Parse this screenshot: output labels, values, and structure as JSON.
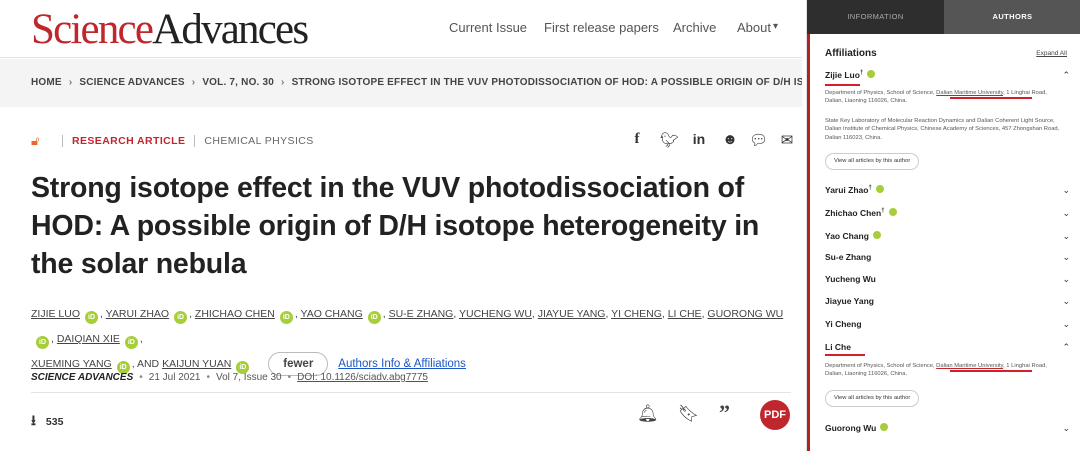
{
  "header": {
    "logo_science": "Science",
    "logo_advances": "Advances",
    "nav": [
      "Current Issue",
      "First release papers",
      "Archive",
      "About"
    ]
  },
  "breadcrumb": [
    "HOME",
    "SCIENCE ADVANCES",
    "VOL. 7, NO. 30",
    "STRONG ISOTOPE EFFECT IN THE VUV PHOTODISSOCIATION OF HOD: A POSSIBLE ORIGIN OF D/H ISOTOPE..."
  ],
  "article": {
    "category": "RESEARCH ARTICLE",
    "subject": "CHEMICAL PHYSICS",
    "title": "Strong isotope effect in the VUV photodissociation of HOD: A possible origin of D/H isotope heterogeneity in the solar nebula",
    "authors": [
      "ZIJIE LUO",
      "YARUI ZHAO",
      "ZHICHAO CHEN",
      "YAO CHANG",
      "SU-E ZHANG",
      "YUCHENG WU",
      "JIAYUE YANG",
      "YI CHENG",
      "LI CHE",
      "GUORONG WU",
      "DAIQIAN XIE",
      "XUEMING YANG",
      "KAIJUN YUAN"
    ],
    "and_text": ", AND",
    "fewer_label": "fewer",
    "authors_info_link": "Authors Info & Affiliations",
    "journal": "SCIENCE ADVANCES",
    "date": "21 Jul 2021",
    "volume": "Vol 7, Issue 30",
    "doi": "DOI: 10.1126/sciadv.abg7775",
    "downloads": "535",
    "pdf_label": "PDF"
  },
  "sidebar": {
    "tabs": [
      "INFORMATION",
      "AUTHORS"
    ],
    "heading": "Affiliations",
    "expand_all": "Expand All",
    "view_all_label": "View all articles by this author",
    "affil1_a": "Department of Physics, School of Science, ",
    "affil1_u": "Dalian Maritime University",
    "affil1_b": ", 1 Linghai Road, Dalian, Liaoning 116026, China.",
    "affil2": "State Key Laboratory of Molecular Reaction Dynamics and Dalian Coherent Light Source, Dalian Institute of Chemical Physics, Chinese Academy of Sciences, 457 Zhongshan Road, Dalian 116023, China.",
    "authors": [
      {
        "name": "Zijie Luo",
        "dagger": "†"
      },
      {
        "name": "Yarui Zhao",
        "dagger": "†"
      },
      {
        "name": "Zhichao Chen",
        "dagger": "†"
      },
      {
        "name": "Yao Chang",
        "dagger": ""
      },
      {
        "name": "Su-e Zhang",
        "dagger": ""
      },
      {
        "name": "Yucheng Wu",
        "dagger": ""
      },
      {
        "name": "Jiayue Yang",
        "dagger": ""
      },
      {
        "name": "Yi Cheng",
        "dagger": ""
      },
      {
        "name": "Li Che",
        "dagger": ""
      },
      {
        "name": "Guorong Wu",
        "dagger": ""
      }
    ]
  }
}
